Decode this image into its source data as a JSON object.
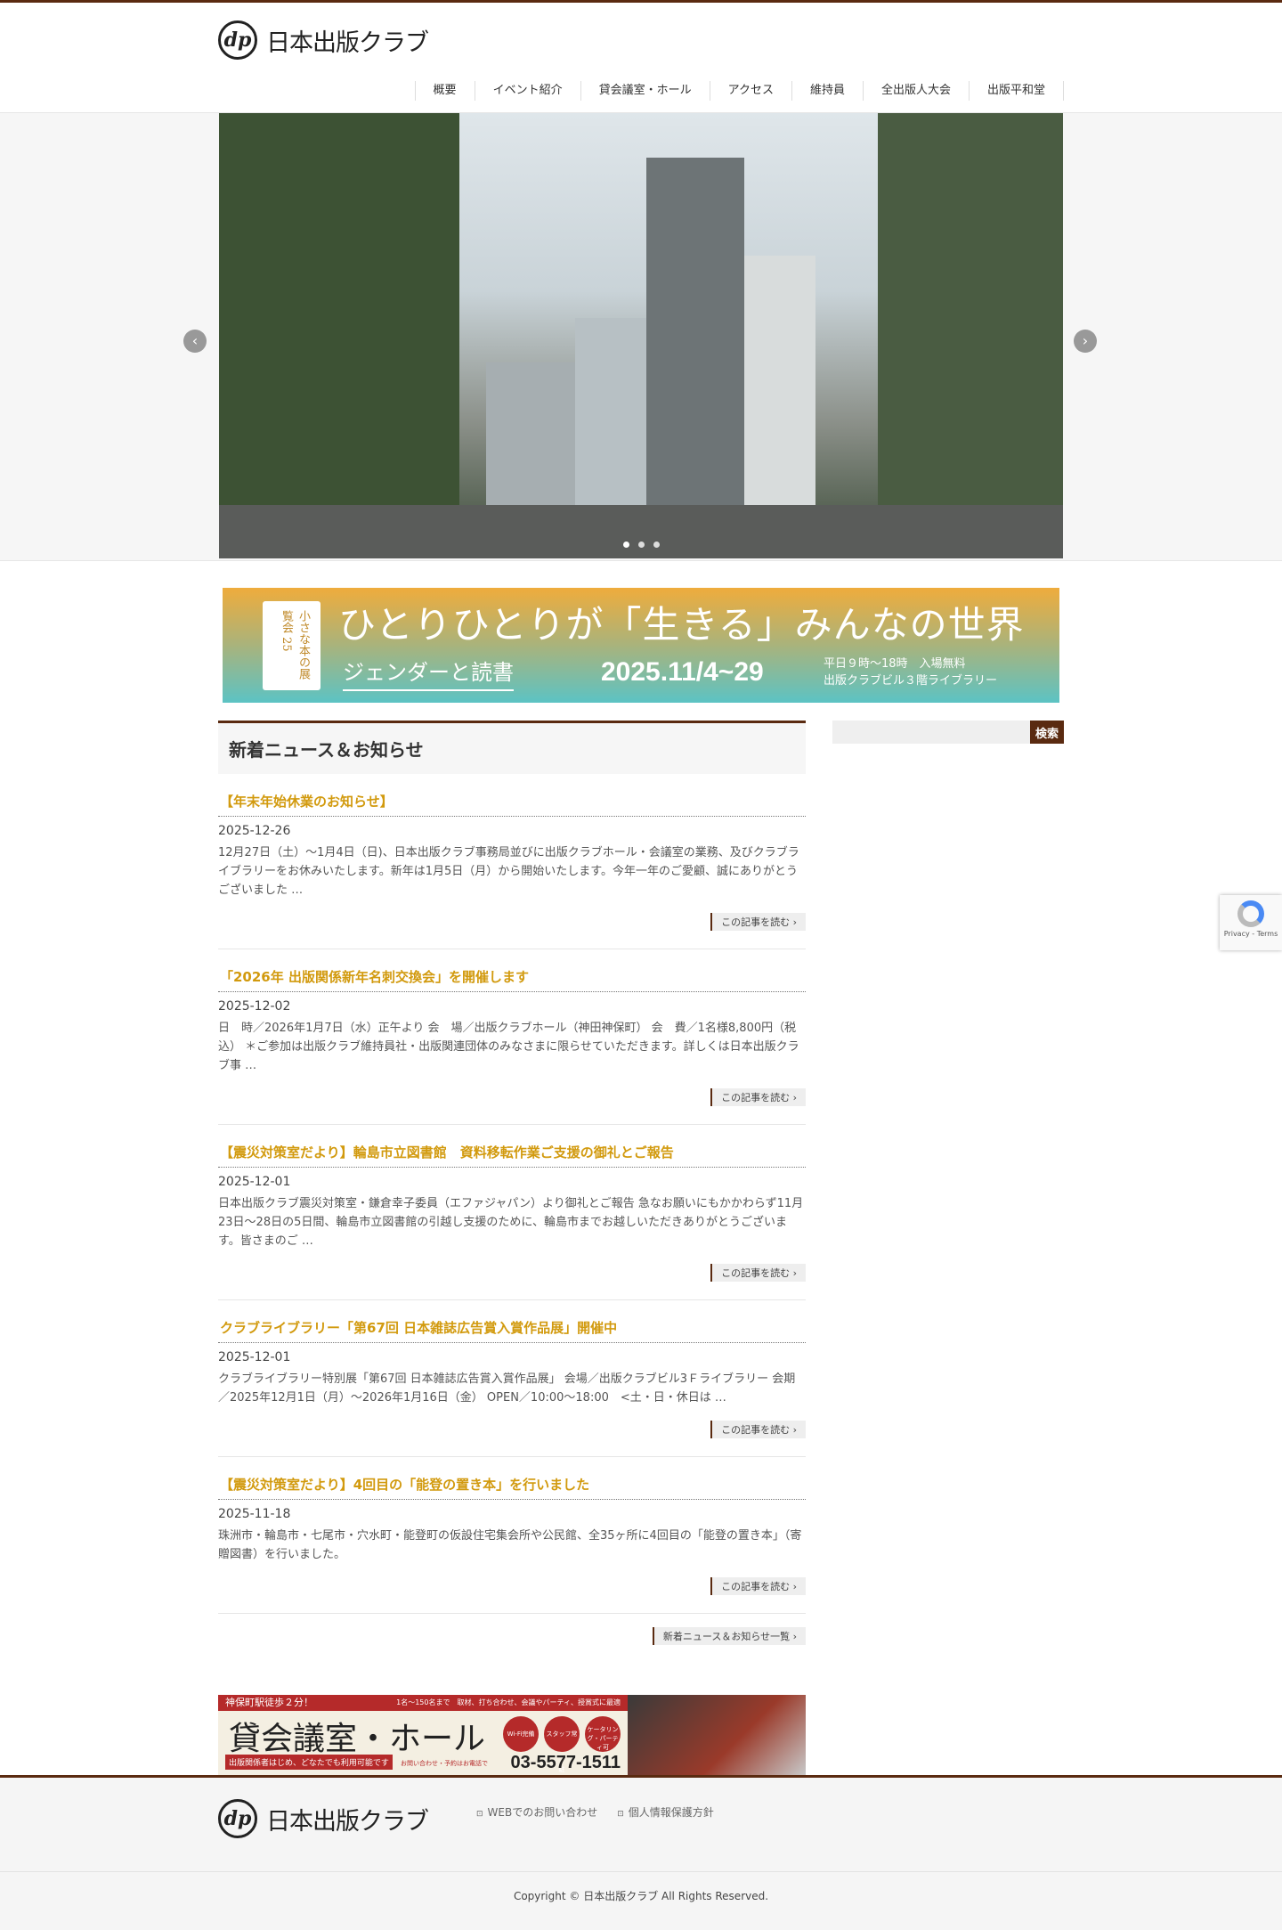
{
  "header": {
    "logo_text": "日本出版クラブ",
    "logo_mark": "dp",
    "nav": [
      "概要",
      "イベント紹介",
      "貸会議室・ホール",
      "アクセス",
      "維持員",
      "全出版人大会",
      "出版平和堂"
    ]
  },
  "hero": {
    "slides": 3,
    "active": 0
  },
  "banner": {
    "book": "小さな本の展覧会",
    "book_no": "25",
    "main": "ひとりひとりが「生きる」みんなの世界",
    "sub": "ジェンダーと読書",
    "date": "2025.11/4~29",
    "info1": "平日９時～18時　入場無料",
    "info2": "出版クラブビル３階ライブラリー"
  },
  "news": {
    "title": "新着ニュース＆お知らせ",
    "read_more": "この記事を読む ›",
    "list_link": "新着ニュース＆お知らせ一覧 ›",
    "items": [
      {
        "title": "【年末年始休業のお知らせ】",
        "date": "2025-12-26",
        "text": "12月27日（土）～1月4日（日)、日本出版クラブ事務局並びに出版クラブホール・会議室の業務、及びクラブライブラリーをお休みいたします。新年は1月5日（月）から開始いたします。今年一年のご愛顧、誠にありがとうございました …"
      },
      {
        "title": "「2026年 出版関係新年名刺交換会」を開催します",
        "date": "2025-12-02",
        "text": "日　時／2026年1月7日（水）正午より 会　場／出版クラブホール（神田神保町） 会　費／1名様8,800円（税込） ＊ご参加は出版クラブ維持員社・出版関連団体のみなさまに限らせていただきます。詳しくは日本出版クラブ事 …"
      },
      {
        "title": "【震災対策室だより】輪島市立図書館　資料移転作業ご支援の御礼とご報告",
        "date": "2025-12-01",
        "text": "日本出版クラブ震災対策室・鎌倉幸子委員（エファジャパン）より御礼とご報告 急なお願いにもかかわらず11月23日～28日の5日間、輪島市立図書館の引越し支援のために、輪島市までお越しいただきありがとうございます。皆さまのご …"
      },
      {
        "title": "クラブライブラリー「第67回 日本雑誌広告賞入賞作品展」開催中",
        "date": "2025-12-01",
        "text": "クラブライブラリー特別展「第67回 日本雑誌広告賞入賞作品展」 会場／出版クラブビル3Ｆライブラリー 会期／2025年12月1日（月）～2026年1月16日（金） OPEN／10:00～18:00　<土・日・休日は …"
      },
      {
        "title": "【震災対策室だより】4回目の「能登の置き本」を行いました",
        "date": "2025-11-18",
        "text": "珠洲市・輪島市・七尾市・穴水町・能登町の仮設住宅集会所や公民館、全35ヶ所に4回目の「能登の置き本」（寄贈図書）を行いました。"
      }
    ]
  },
  "rental": {
    "top_left": "神保町駅徒歩２分！",
    "top_right": "1名～150名まで　取材、打ち合わせ、会議やパーティ、授賞式に最適",
    "title": "貸会議室・ホール",
    "badges": [
      "Wi-Fi完備",
      "スタッフ常駐",
      "ケータリング・パーティ可"
    ],
    "tag": "出版関係者はじめ、どなたでも利用可能です",
    "tel_label": "お問い合わせ・予約はお電話で",
    "tel": "03-5577-1511"
  },
  "sidebar": {
    "search_button": "検索"
  },
  "footer": {
    "logo_text": "日本出版クラブ",
    "links": [
      "WEBでのお問い合わせ",
      "個人情報保護方針"
    ],
    "copyright": "Copyright © 日本出版クラブ All Rights Reserved."
  },
  "recaptcha": {
    "text": "Privacy - Terms"
  }
}
